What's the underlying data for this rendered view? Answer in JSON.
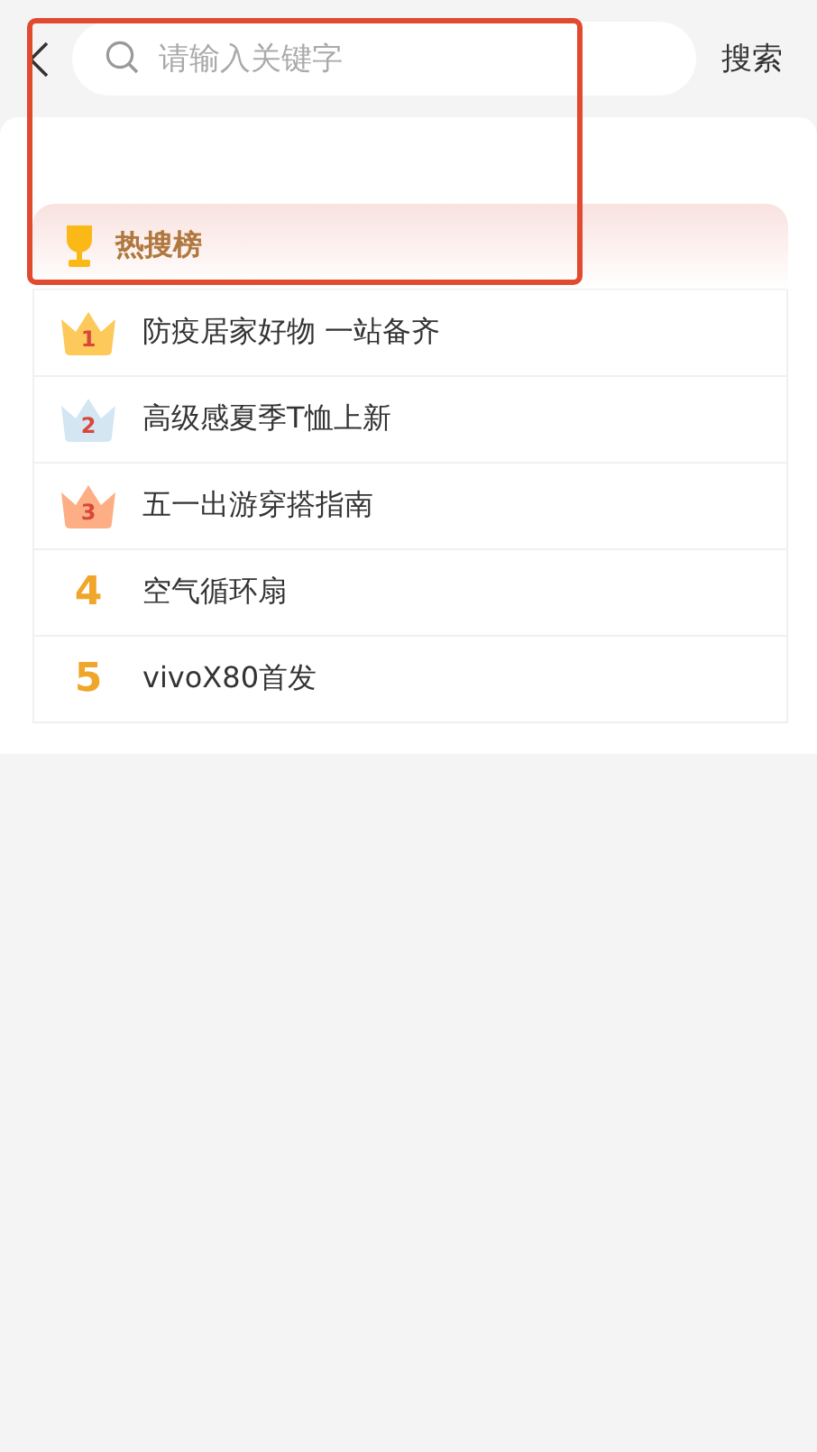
{
  "search": {
    "placeholder": "请输入关键字",
    "button": "搜索"
  },
  "hot_list": {
    "title": "热搜榜",
    "items": [
      {
        "rank": "1",
        "kind": "crown",
        "color": "#fcc95a",
        "text": "防疫居家好物 一站备齐"
      },
      {
        "rank": "2",
        "kind": "crown",
        "color": "#d3e6f1",
        "text": "高级感夏季T恤上新"
      },
      {
        "rank": "3",
        "kind": "crown",
        "color": "#fdae85",
        "text": "五一出游穿搭指南"
      },
      {
        "rank": "4",
        "kind": "number",
        "text": "空气循环扇"
      },
      {
        "rank": "5",
        "kind": "number",
        "text": "vivoX80首发"
      }
    ]
  }
}
